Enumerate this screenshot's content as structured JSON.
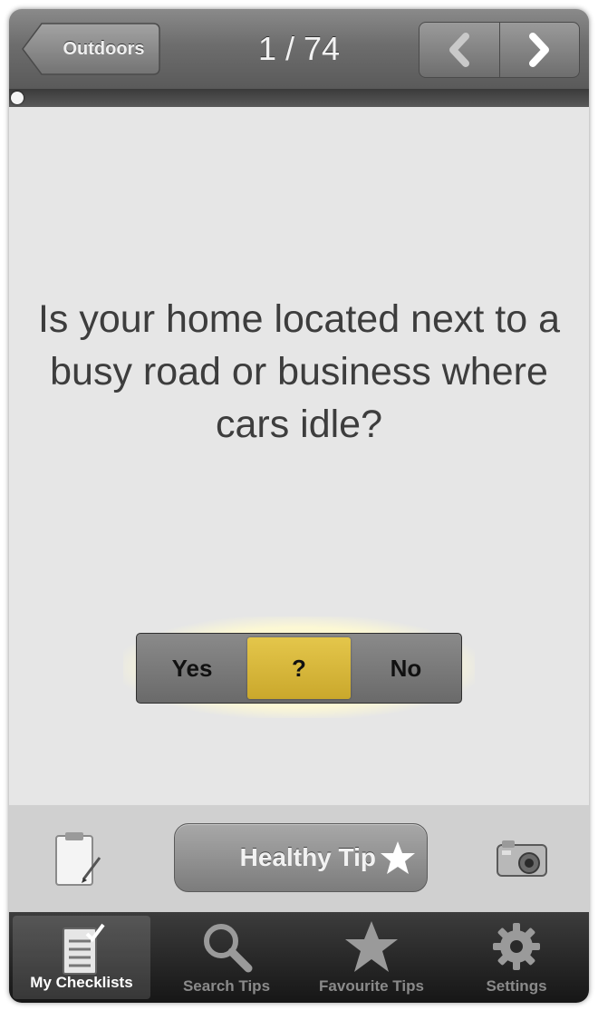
{
  "navbar": {
    "back_label": "Outdoors",
    "counter": "1 / 74",
    "prev_icon": "chevron-left-icon",
    "next_icon": "chevron-right-icon"
  },
  "progress": {
    "current": 1,
    "total": 74
  },
  "question": "Is your home located next to a busy road or business where cars idle?",
  "answers": {
    "options": [
      "Yes",
      "?",
      "No"
    ],
    "selected": "?"
  },
  "actions": {
    "left_icon": "clipboard-icon",
    "tip_label": "Healthy Tip",
    "tip_icon": "star-icon",
    "right_icon": "camera-icon"
  },
  "tabbar": {
    "tabs": [
      {
        "label": "My Checklists",
        "icon": "checklist-icon",
        "active": true
      },
      {
        "label": "Search Tips",
        "icon": "search-icon",
        "active": false
      },
      {
        "label": "Favourite Tips",
        "icon": "star-icon",
        "active": false
      },
      {
        "label": "Settings",
        "icon": "gear-icon",
        "active": false
      }
    ]
  },
  "colors": {
    "selected_answer": "#d9b83b",
    "navbar": "#6d6d6d",
    "tabbar": "#222222"
  }
}
